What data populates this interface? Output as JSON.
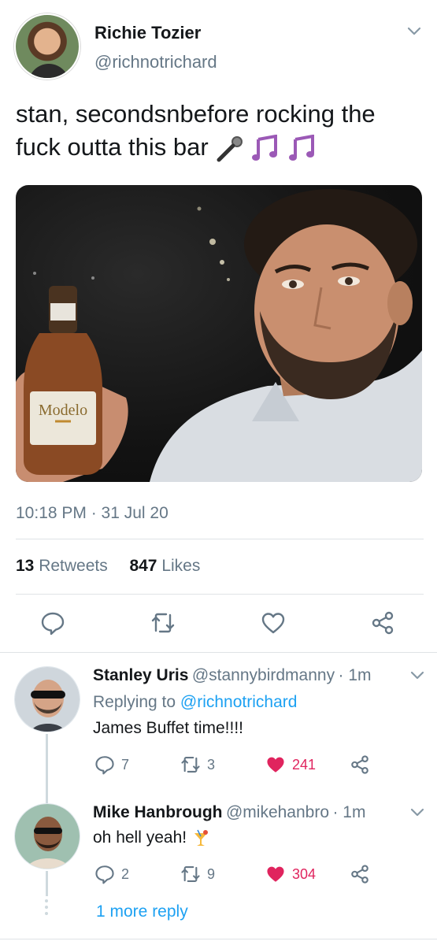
{
  "tweet": {
    "author_name": "Richie Tozier",
    "author_handle": "@richnotrichard",
    "text_line1": "stan, secondsnbefore rocking the",
    "text_line2": "fuck outta this bar",
    "emoji": [
      "microphone",
      "musical-notes",
      "musical-notes"
    ],
    "photo_label": "Modelo",
    "timestamp": "10:18 PM · 31 Jul 20",
    "retweets_count": "13",
    "retweets_label": "Retweets",
    "likes_count": "847",
    "likes_label": "Likes"
  },
  "replies": [
    {
      "name": "Stanley Uris",
      "handle": "@stannybirdmanny",
      "time": "· 1m",
      "replying_prefix": "Replying to",
      "replying_to": "@richnotrichard",
      "text": "James Buffet time!!!!",
      "reply_count": "7",
      "retweet_count": "3",
      "like_count": "241",
      "liked": true
    },
    {
      "name": "Mike Hanbrough",
      "handle": "@mikehanbro",
      "time": "· 1m",
      "text": "oh hell yeah!",
      "reply_count": "2",
      "retweet_count": "9",
      "like_count": "304",
      "liked": true
    }
  ],
  "more_replies_label": "1 more reply",
  "colors": {
    "accent": "#1da1f2",
    "like": "#e0245e",
    "secondary_text": "#657786",
    "primary_text": "#14171a"
  }
}
